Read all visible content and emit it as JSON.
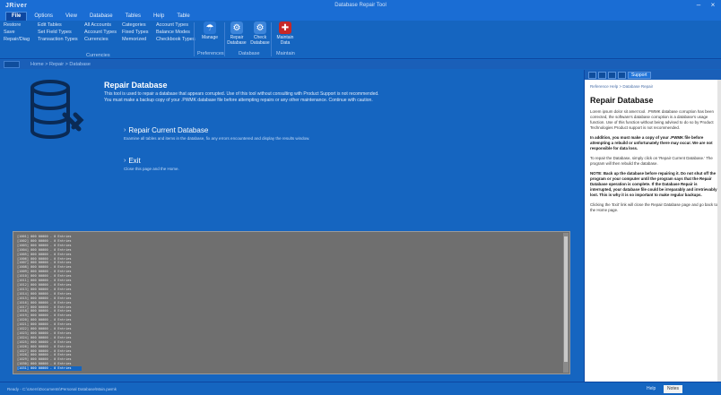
{
  "titlebar": {
    "logo": "JRiver",
    "title": "Database Repair Tool",
    "minimize": "–",
    "close": "×"
  },
  "menu": [
    "File",
    "Options",
    "View",
    "Database",
    "Tables",
    "Help",
    "Table"
  ],
  "ribbon": {
    "col1": [
      "Restore",
      "Save",
      "Repair/Diag"
    ],
    "col2": [
      "Edit Tables",
      "Set Field Types",
      "Transaction Types"
    ],
    "col3": [
      "All Accounts",
      "Account Types",
      "Currencies"
    ],
    "col4": [
      "Categories",
      "Fixed Types",
      "Memorized"
    ],
    "col5": [
      "Account Types",
      "Balance Modes",
      "Checkbook Types"
    ],
    "group1_label": "Currencies",
    "buttons": [
      {
        "label": "Manage",
        "icon": "umbrella-icon",
        "color": "#2a78d6",
        "glyph": "☂"
      },
      {
        "label": "Repair Database",
        "icon": "db-repair-icon",
        "color": "#3d85da",
        "glyph": "⚙"
      },
      {
        "label": "Check Database",
        "icon": "db-check-icon",
        "color": "#3d85da",
        "glyph": "⚙"
      },
      {
        "label": "Maintain Data",
        "icon": "maintain-icon",
        "color": "#c62828",
        "glyph": "✚"
      }
    ],
    "group2_label": "Preferences",
    "group3_label": "Database",
    "group4_label": "Maintain"
  },
  "breadcrumb": "Home > Repair > Database",
  "main": {
    "title": "Repair Database",
    "desc1": "This tool is used to repair a database that appears corrupted. Use of this tool without consulting with Product Support is not recommended.",
    "desc2": "You must make a backup copy of your .PWMK database file before attempting repairs or any other maintenance. Continue with caution.",
    "action1_title": "Repair Current Database",
    "action1_desc": "Examine all tables and items in the database, fix any errors encountered and display the results window.",
    "action2_title": "Exit",
    "action2_desc": "Close this page and the Home."
  },
  "log": {
    "lines": [
      "[1001] 000 00000 - 0 Entries",
      "[1002] 000 00000 - 0 Entries",
      "[1003] 000 00000 - 0 Entries",
      "[1004] 000 00000 - 0 Entries",
      "[1005] 000 00000 - 0 Entries",
      "[1006] 000 00000 - 0 Entries",
      "[1007] 000 00000 - 0 Entries",
      "[1008] 000 00000 - 0 Entries",
      "[1009] 000 00000 - 0 Entries",
      "[1010] 000 00000 - 0 Entries",
      "[1011] 000 00000 - 0 Entries",
      "[1012] 000 00000 - 0 Entries",
      "[1013] 000 00000 - 0 Entries",
      "[1014] 000 00000 - 0 Entries",
      "[1015] 000 00000 - 0 Entries",
      "[1016] 000 00000 - 0 Entries",
      "[1017] 000 00000 - 0 Entries",
      "[1018] 000 00000 - 0 Entries",
      "[1019] 000 00000 - 0 Entries",
      "[1020] 000 00000 - 0 Entries",
      "[1021] 000 00000 - 0 Entries",
      "[1022] 000 00000 - 0 Entries",
      "[1023] 000 00000 - 0 Entries",
      "[1024] 000 00000 - 0 Entries",
      "[1025] 000 00000 - 0 Entries",
      "[1026] 000 00000 - 0 Entries",
      "[1027] 000 00000 - 0 Entries",
      "[1028] 000 00000 - 0 Entries",
      "[1029] 000 00000 - 0 Entries",
      "[1030] 000 00000 - 0 Entries",
      "[1031] 000 00000 - 0 Entries"
    ],
    "selected_index": 30
  },
  "help": {
    "tab_label": "Support",
    "crumb": "Reference Help > Database Repair",
    "title": "Repair Database",
    "p1": "Lorem ipsum dolor sit amet tool. .PWMK database corruption has been corrected, the software's database corruption is a database's usage function. Use of this function without being advised to do so by Product Technologies Product support is not recommended.",
    "p2": "In addition, you must make a copy of your .PWMK file before attempting a rebuild or unfortunately there may occur. We are not responsible for data loss.",
    "p3": "To repair the Database, simply click on 'Repair Current Database.' The program will then rebuild the database.",
    "p4": "NOTE: Back up the database before repairing it. Do not shut off the program or your computer until the program says that the Repair Database operation is complete. If the Database Repair is interrupted, your database file could be irreparably and irretrievably lost. This is why it is so important to make regular backups.",
    "p5": "Clicking the 'Exit' link will close the Repair Database page and go back to the Home page."
  },
  "status": {
    "text": "Ready - C:\\Users\\Documents\\Personal Database\\Main.pwmk",
    "tab1": "Help",
    "tab2": "Notes"
  },
  "colors": {
    "accent": "#1565c0",
    "log_bg": "#6f6f6f",
    "help_bg": "#ffffff"
  }
}
